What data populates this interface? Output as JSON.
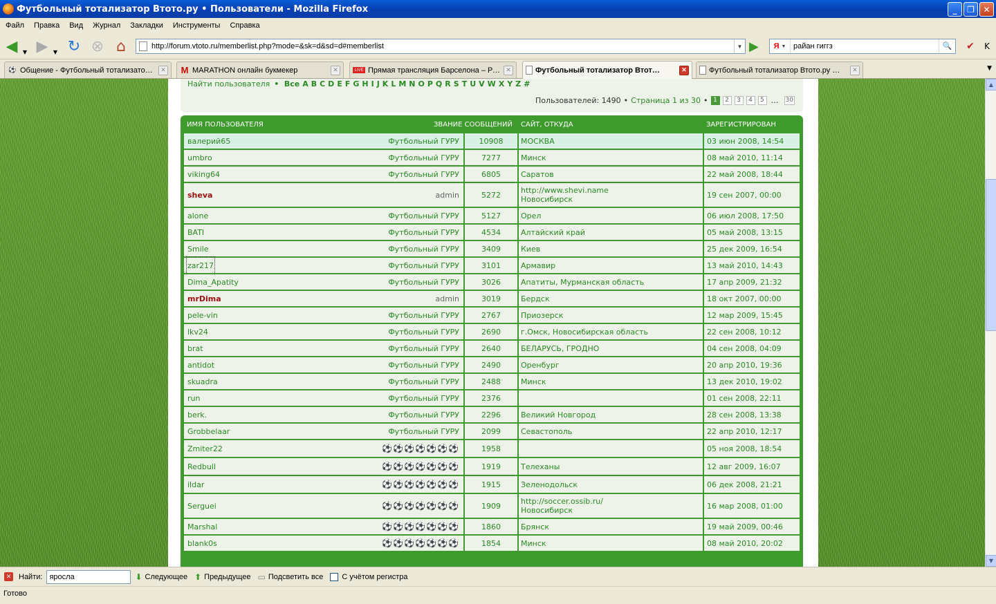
{
  "window": {
    "title": "Футбольный тотализатор Втото.ру • Пользователи - Mozilla Firefox"
  },
  "menu": [
    "Файл",
    "Правка",
    "Вид",
    "Журнал",
    "Закладки",
    "Инструменты",
    "Справка"
  ],
  "nav": {
    "url": "http://forum.vtoto.ru/memberlist.php?mode=&sk=d&sd=d#memberlist",
    "search_engine": "Я",
    "search_value": "райан гиггз"
  },
  "tabs": [
    {
      "label": "Общение - Футбольный тотализато…",
      "icon": "soccer-ball-icon"
    },
    {
      "label": "MARATHON онлайн букмекер",
      "icon": "marathon-icon"
    },
    {
      "label": "Прямая трансляция Барселона – Ре…",
      "icon": "live-icon"
    },
    {
      "label": "Футбольный тотализатор Втот…",
      "icon": "page-icon",
      "active": true
    },
    {
      "label": "Футбольный тотализатор Втото.ру …",
      "icon": "page-icon"
    }
  ],
  "memberlist": {
    "find_label": "Найти пользователя",
    "letters": [
      "Все",
      "A",
      "B",
      "C",
      "D",
      "E",
      "F",
      "G",
      "H",
      "I",
      "J",
      "K",
      "L",
      "M",
      "N",
      "O",
      "P",
      "Q",
      "R",
      "S",
      "T",
      "U",
      "V",
      "W",
      "X",
      "Y",
      "Z",
      "#"
    ],
    "users_count_text": "Пользователей: 1490",
    "page_text": "Страница 1 из 30",
    "pages": [
      "1",
      "2",
      "3",
      "4",
      "5",
      "…",
      "30"
    ],
    "columns": {
      "name": "Имя пользователя",
      "rank_posts": "Звание Сообщений",
      "site": "Сайт, откуда",
      "joined": "Зарегистрирован"
    },
    "rows": [
      {
        "name": "валерий65",
        "rank": "Футбольный ГУРУ",
        "posts": "10908",
        "loc1": "МОСКВА",
        "loc2": "",
        "joined": "03 июн 2008, 14:54",
        "hl": true
      },
      {
        "name": "umbro",
        "rank": "Футбольный ГУРУ",
        "posts": "7277",
        "loc1": "Минск",
        "loc2": "",
        "joined": "08 май 2010, 11:14"
      },
      {
        "name": "viking64",
        "rank": "Футбольный ГУРУ",
        "posts": "6805",
        "loc1": "Саратов",
        "loc2": "",
        "joined": "22 май 2008, 18:44"
      },
      {
        "name": "sheva",
        "rank": "admin",
        "posts": "5272",
        "loc1": "http://www.shevi.name",
        "loc2": "Новосибирск",
        "joined": "19 сен 2007, 00:00",
        "admin": true
      },
      {
        "name": "alone",
        "rank": "Футбольный ГУРУ",
        "posts": "5127",
        "loc1": "Орел",
        "loc2": "",
        "joined": "06 июл 2008, 17:50"
      },
      {
        "name": "BATI",
        "rank": "Футбольный ГУРУ",
        "posts": "4534",
        "loc1": "Алтайский край",
        "loc2": "",
        "joined": "05 май 2008, 13:15"
      },
      {
        "name": "Smile",
        "rank": "Футбольный ГУРУ",
        "posts": "3409",
        "loc1": "Киев",
        "loc2": "",
        "joined": "25 дек 2009, 16:54"
      },
      {
        "name": "zar217",
        "rank": "Футбольный ГУРУ",
        "posts": "3101",
        "loc1": "Армавир",
        "loc2": "",
        "joined": "13 май 2010, 14:43",
        "focus": true
      },
      {
        "name": "Dima_Apatity",
        "rank": "Футбольный ГУРУ",
        "posts": "3026",
        "loc1": "Апатиты, Мурманская область",
        "loc2": "",
        "joined": "17 апр 2009, 21:32"
      },
      {
        "name": "mrDima",
        "rank": "admin",
        "posts": "3019",
        "loc1": "Бердск",
        "loc2": "",
        "joined": "18 окт 2007, 00:00",
        "admin": true
      },
      {
        "name": "pele-vin",
        "rank": "Футбольный ГУРУ",
        "posts": "2767",
        "loc1": "Приозерск",
        "loc2": "",
        "joined": "12 мар 2009, 15:45"
      },
      {
        "name": "lkv24",
        "rank": "Футбольный ГУРУ",
        "posts": "2690",
        "loc1": "г.Омск, Новосибирская область",
        "loc2": "",
        "joined": "22 сен 2008, 10:12"
      },
      {
        "name": "brat",
        "rank": "Футбольный ГУРУ",
        "posts": "2640",
        "loc1": "БЕЛАРУСЬ, ГРОДНО",
        "loc2": "",
        "joined": "04 сен 2008, 04:09"
      },
      {
        "name": "antidot",
        "rank": "Футбольный ГУРУ",
        "posts": "2490",
        "loc1": "Оренбург",
        "loc2": "",
        "joined": "20 апр 2010, 19:36"
      },
      {
        "name": "skuadra",
        "rank": "Футбольный ГУРУ",
        "posts": "2488",
        "loc1": "Минск",
        "loc2": "",
        "joined": "13 дек 2010, 19:02"
      },
      {
        "name": "run",
        "rank": "Футбольный ГУРУ",
        "posts": "2376",
        "loc1": "",
        "loc2": "",
        "joined": "01 сен 2008, 22:11"
      },
      {
        "name": "berk.",
        "rank": "Футбольный ГУРУ",
        "posts": "2296",
        "loc1": "Великий Новгород",
        "loc2": "",
        "joined": "28 сен 2008, 13:38"
      },
      {
        "name": "Grobbelaar",
        "rank": "Футбольный ГУРУ",
        "posts": "2099",
        "loc1": "Севастополь",
        "loc2": "",
        "joined": "22 апр 2010, 12:17"
      },
      {
        "name": "Zmiter22",
        "rank": "balls",
        "posts": "1958",
        "loc1": "",
        "loc2": "",
        "joined": "05 ноя 2008, 18:54"
      },
      {
        "name": "Redbull",
        "rank": "balls",
        "posts": "1919",
        "loc1": "Телеханы",
        "loc2": "",
        "joined": "12 авг 2009, 16:07"
      },
      {
        "name": "ildar",
        "rank": "balls",
        "posts": "1915",
        "loc1": "Зеленодольск",
        "loc2": "",
        "joined": "06 дек 2008, 21:21"
      },
      {
        "name": "Serguei",
        "rank": "balls",
        "posts": "1909",
        "loc1": "http://soccer.ossib.ru/",
        "loc2": "Новосибирск",
        "joined": "16 мар 2008, 01:00"
      },
      {
        "name": "Marshal",
        "rank": "balls",
        "posts": "1860",
        "loc1": "Брянск",
        "loc2": "",
        "joined": "19 май 2009, 00:46"
      },
      {
        "name": "blank0s",
        "rank": "balls",
        "posts": "1854",
        "loc1": "Минск",
        "loc2": "",
        "joined": "08 май 2010, 20:02"
      }
    ]
  },
  "findbar": {
    "label": "Найти:",
    "value": "яросла",
    "next": "Следующее",
    "prev": "Предыдущее",
    "highlight": "Подсветить все",
    "match_case": "С учётом регистра"
  },
  "status": "Готово"
}
